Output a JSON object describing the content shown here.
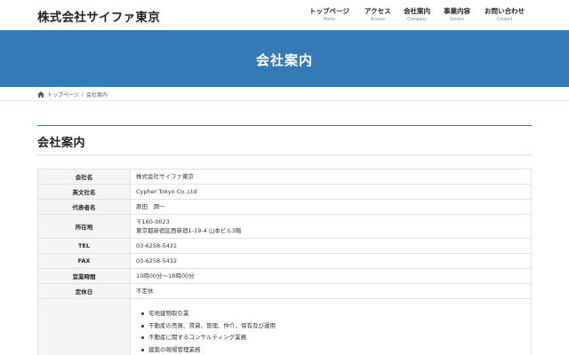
{
  "site": {
    "title": "株式会社サイファ東京"
  },
  "nav": [
    {
      "ja": "トップページ",
      "en": "Home"
    },
    {
      "ja": "アクセス",
      "en": "Access"
    },
    {
      "ja": "会社案内",
      "en": "Company"
    },
    {
      "ja": "事業内容",
      "en": "Service"
    },
    {
      "ja": "お問い合わせ",
      "en": "Contact"
    }
  ],
  "banner": {
    "title": "会社案内"
  },
  "breadcrumb": {
    "home": "トップページ",
    "separator": "/",
    "current": "会社案内"
  },
  "page": {
    "heading": "会社案内"
  },
  "table": {
    "rows": [
      {
        "label": "会社名",
        "value": "株式会社サイファ東京"
      },
      {
        "label": "英文社名",
        "value": "Cypher Tokyo Co.,Ltd"
      },
      {
        "label": "代表者名",
        "value": "原田　潤一"
      },
      {
        "label": "所在地",
        "lines": [
          "〒160-0023",
          "東京都新宿区西新宿1-19-4 山本ビル3階"
        ]
      },
      {
        "label": "TEL",
        "value": "03-6258-5431"
      },
      {
        "label": "FAX",
        "value": "03-6258-5432"
      },
      {
        "label": "営業時間",
        "value": "10時00分～18時00分"
      },
      {
        "label": "定休日",
        "value": "不定休"
      },
      {
        "label": "",
        "items": [
          "宅地建物取引業",
          "不動産の売買、賃貸、管理、仲介、保有及び運用",
          "不動産に関するコンサルティング業務",
          "建築の現場管理業務"
        ]
      }
    ]
  },
  "colors": {
    "accent": "#337ab7",
    "header_bg": "#f5f5f5"
  }
}
